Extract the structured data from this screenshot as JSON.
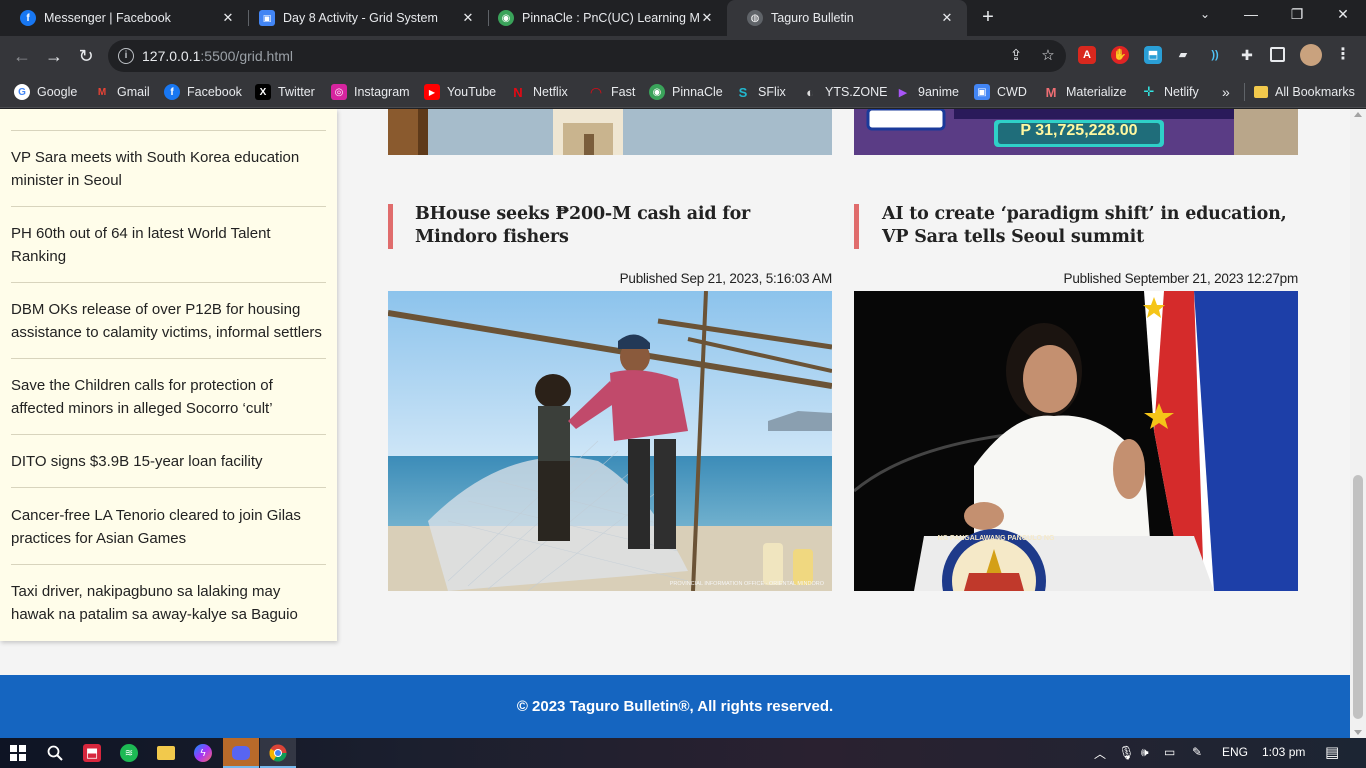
{
  "tabs": [
    {
      "title": "Messenger | Facebook",
      "icon": "facebook-icon",
      "color": "#1877f2",
      "glyph": "f"
    },
    {
      "title": "Day 8 Activity - Grid System",
      "icon": "classroom-icon",
      "color": "#4285f4",
      "glyph": "▣"
    },
    {
      "title": "PinnaCle : PnC(UC) Learning Ma",
      "icon": "pinnacle-icon",
      "color": "#3aa35a",
      "glyph": "◉"
    },
    {
      "title": "Taguro Bulletin",
      "icon": "globe-icon",
      "color": "#5f6368",
      "glyph": "◍"
    }
  ],
  "toolbar": {
    "url_host": "127.0.0.1",
    "url_rest": ":5500/grid.html"
  },
  "bookmarks": [
    {
      "label": "Google",
      "color": "#ffffff",
      "glyph": "G",
      "fg": "#4285f4"
    },
    {
      "label": "Gmail",
      "color": "#35363a",
      "glyph": "M",
      "fg": "#ea4335"
    },
    {
      "label": "Facebook",
      "color": "#1877f2",
      "glyph": "f",
      "fg": "#ffffff"
    },
    {
      "label": "Twitter",
      "color": "#000000",
      "glyph": "X",
      "fg": "#ffffff"
    },
    {
      "label": "Instagram",
      "color": "#d6249f",
      "glyph": "◎",
      "fg": "#ffffff"
    },
    {
      "label": "YouTube",
      "color": "#ff0000",
      "glyph": "▶",
      "fg": "#ffffff"
    },
    {
      "label": "Netflix",
      "color": "#35363a",
      "glyph": "N",
      "fg": "#e50914"
    },
    {
      "label": "Fast",
      "color": "#35363a",
      "glyph": "◠",
      "fg": "#e50914"
    },
    {
      "label": "PinnaCle",
      "color": "#3aa35a",
      "glyph": "◉",
      "fg": "#ffffff"
    },
    {
      "label": "SFlix",
      "color": "#35363a",
      "glyph": "S",
      "fg": "#22b8cf"
    },
    {
      "label": "YTS.ZONE",
      "color": "#35363a",
      "glyph": "◐",
      "fg": "#dddddd"
    },
    {
      "label": "9anime",
      "color": "#35363a",
      "glyph": "▶",
      "fg": "#a855f7"
    },
    {
      "label": "CWD",
      "color": "#4285f4",
      "glyph": "▣",
      "fg": "#ffffff"
    },
    {
      "label": "Materialize",
      "color": "#35363a",
      "glyph": "M",
      "fg": "#ee6e73"
    },
    {
      "label": "Netlify",
      "color": "#35363a",
      "glyph": "✛",
      "fg": "#32e6e2"
    }
  ],
  "bookmarks_overflow": "»",
  "all_bookmarks": "All Bookmarks",
  "sidebar": {
    "items": [
      "VP Sara meets with South Korea education minister in Seoul",
      "PH 60th out of 64 in latest World Talent Ranking",
      "DBM OKs release of over P12B for housing assistance to calamity victims, informal settlers",
      "Save the Children calls for protection of affected minors in alleged Socorro ‘cult’",
      "DITO signs $3.9B 15-year loan facility",
      "Cancer-free LA Tenorio cleared to join Gilas practices for Asian Games",
      "Taxi driver, nakipagbuno sa lalaking may hawak na patalim sa away-kalye sa Baguio"
    ]
  },
  "top_banner_right_amount": "P 31,725,228.00",
  "articles": [
    {
      "headline": "BHouse seeks ₱200-M cash aid for Mindoro fishers",
      "published": "Published Sep 21, 2023, 5:16:03 AM",
      "photo_credit": "PROVINCIAL INFORMATION OFFICE - ORIENTAL MINDORO"
    },
    {
      "headline": "AI to create ‘paradigm shift’ in education, VP Sara tells Seoul summit",
      "published": "Published September 21, 2023 12:27pm",
      "podium_text": "NG PANGALAWANG PANGULO NG P"
    }
  ],
  "footer": {
    "copyright": "© 2023 Taguro Bulletin®, All rights reserved."
  },
  "taskbar": {
    "language": "ENG",
    "time": "1:03 pm"
  },
  "colors": {
    "accent_bar": "#e06c6c",
    "footer_bg": "#1565c0",
    "sidebar_bg": "#fffdea"
  }
}
